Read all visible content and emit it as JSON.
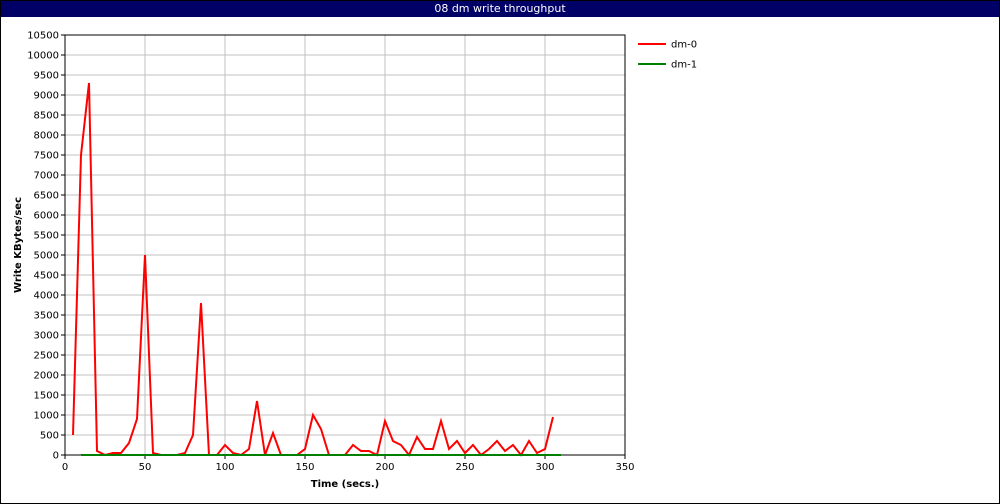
{
  "window": {
    "title": "08 dm write throughput"
  },
  "chart_data": {
    "type": "line",
    "title": "08 dm write throughput",
    "xlabel": "Time (secs.)",
    "ylabel": "Write KBytes/sec",
    "xlim": [
      0,
      350
    ],
    "ylim": [
      0,
      10500
    ],
    "xticks": [
      0,
      50,
      100,
      150,
      200,
      250,
      300,
      350
    ],
    "yticks": [
      0,
      500,
      1000,
      1500,
      2000,
      2500,
      3000,
      3500,
      4000,
      4500,
      5000,
      5500,
      6000,
      6500,
      7000,
      7500,
      8000,
      8500,
      9000,
      9500,
      10000,
      10500
    ],
    "grid": true,
    "legend_position": "right",
    "series": [
      {
        "name": "dm-0",
        "color": "#ff0000",
        "x": [
          5,
          10,
          15,
          20,
          25,
          30,
          35,
          40,
          45,
          50,
          55,
          60,
          65,
          70,
          75,
          80,
          85,
          90,
          95,
          100,
          105,
          110,
          115,
          120,
          125,
          130,
          135,
          140,
          145,
          150,
          155,
          160,
          165,
          170,
          175,
          180,
          185,
          190,
          195,
          200,
          205,
          210,
          215,
          220,
          225,
          230,
          235,
          240,
          245,
          250,
          255,
          260,
          265,
          270,
          275,
          280,
          285,
          290,
          295,
          300,
          305
        ],
        "values": [
          500,
          7500,
          9300,
          100,
          0,
          50,
          50,
          300,
          900,
          5000,
          50,
          0,
          0,
          0,
          50,
          500,
          3800,
          0,
          0,
          250,
          50,
          0,
          150,
          1350,
          0,
          550,
          0,
          0,
          0,
          150,
          1000,
          650,
          0,
          0,
          0,
          250,
          100,
          100,
          0,
          850,
          350,
          250,
          0,
          450,
          150,
          150,
          850,
          150,
          350,
          50,
          250,
          0,
          150,
          350,
          100,
          250,
          0,
          350,
          50,
          150,
          950
        ]
      },
      {
        "name": "dm-1",
        "color": "#008000",
        "x": [
          10,
          310
        ],
        "values": [
          0,
          0
        ]
      }
    ]
  }
}
